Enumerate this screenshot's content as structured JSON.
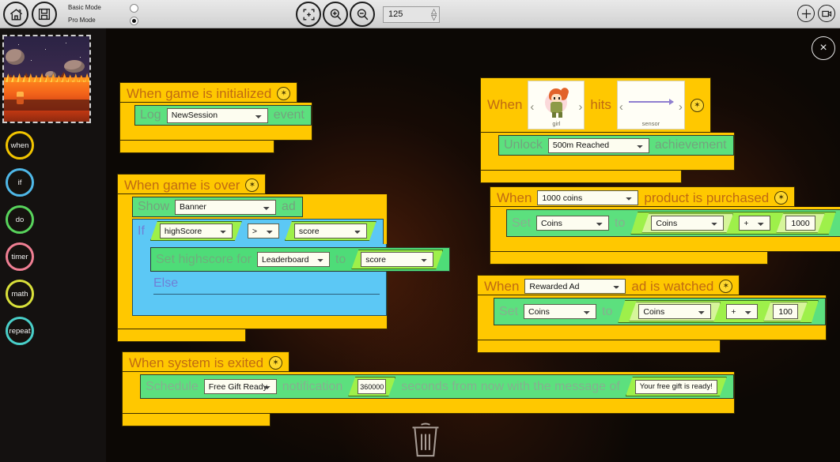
{
  "toolbar": {
    "home_icon": "home-icon",
    "save_icon": "save-icon",
    "basic_mode_label": "Basic Mode",
    "pro_mode_label": "Pro Mode",
    "fit_icon": "fit-to-screen-icon",
    "zoom_in_icon": "zoom-in-icon",
    "zoom_out_icon": "zoom-out-icon",
    "zoom_value": "125",
    "move_icon": "move-crosshair-icon",
    "record_icon": "video-camera-icon"
  },
  "sidebar": {
    "scene_thumbnail": "scene-thumbnail",
    "palette": [
      {
        "label": "when",
        "color": "#f2c500"
      },
      {
        "label": "if",
        "color": "#4fb8e8"
      },
      {
        "label": "do",
        "color": "#58d45c"
      },
      {
        "label": "timer",
        "color": "#f07f93"
      },
      {
        "label": "math",
        "color": "#d9e03a"
      },
      {
        "label": "repeat",
        "color": "#49cfc9"
      }
    ]
  },
  "canvas": {
    "close_label": "×",
    "trash_icon": "trash-icon",
    "gear_icon": "settings-gear-icon"
  },
  "scripts": {
    "game_initialized": {
      "hat": "When game is initialized",
      "log_label": "Log",
      "log_value": "NewSession",
      "event_label": "event"
    },
    "girl_hits_sensor": {
      "when_label": "When",
      "sprite_caption": "girl",
      "hits_label": "hits",
      "sensor_caption": "sensor",
      "unlock_label": "Unlock",
      "achievement_value": "500m Reached",
      "achievement_label": "achievement"
    },
    "game_over": {
      "hat": "When game is over",
      "show_label": "Show",
      "ad_value": "Banner",
      "ad_label": "ad",
      "if_label": "If",
      "if_left": "highScore",
      "if_operator": ">",
      "if_right": "score",
      "set_highscore_label": "Set highscore for",
      "leaderboard_value": "Leaderboard",
      "to_label": "to",
      "highscore_value": "score",
      "else_label": "Else"
    },
    "product_purchased": {
      "when_label": "When",
      "product_value": "1000 coins",
      "hat_tail": "product is purchased",
      "set_label": "Set",
      "set_target": "Coins",
      "to_label": "to",
      "operand_left": "Coins",
      "operator": "+",
      "operand_right": "1000"
    },
    "ad_watched": {
      "when_label": "When",
      "ad_value": "Rewarded Ad",
      "hat_tail": "ad is watched",
      "set_label": "Set",
      "set_target": "Coins",
      "to_label": "to",
      "operand_left": "Coins",
      "operator": "+",
      "operand_right": "100"
    },
    "system_exited": {
      "hat": "When system is exited",
      "schedule_label": "Schedule",
      "notification_value": "Free Gift Ready",
      "notification_label": "notification",
      "seconds_value": "360000",
      "seconds_label": "seconds from now with the message of",
      "message_value": "Your free gift is ready!"
    }
  }
}
